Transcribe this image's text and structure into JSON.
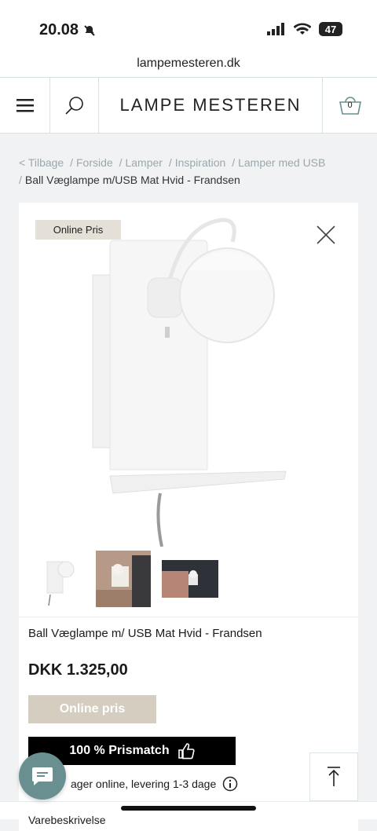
{
  "status": {
    "time": "20.08",
    "battery": "47"
  },
  "browser": {
    "url": "lampemesteren.dk"
  },
  "header": {
    "logo_text": "LAMPE MESTEREN",
    "cart_count": "0"
  },
  "breadcrumb": {
    "items": [
      "Tilbage",
      "Forside",
      "Lamper",
      "Inspiration",
      "Lamper med USB"
    ],
    "current": "Ball Væglampe m/USB Mat Hvid - Frandsen"
  },
  "product": {
    "badge": "Online Pris",
    "title": "Ball Væglampe m/ USB Mat Hvid - Frandsen",
    "price": "DKK 1.325,00",
    "online_button": "Online pris",
    "prismatch_label": "100 % Prismatch",
    "delivery": "ager online, levering 1-3 dage",
    "more_partial": "Varebeskrivelse"
  },
  "colors": {
    "accent": "#6a8f90",
    "beige": "#d5cdbf",
    "badge": "#e4dfd7"
  }
}
